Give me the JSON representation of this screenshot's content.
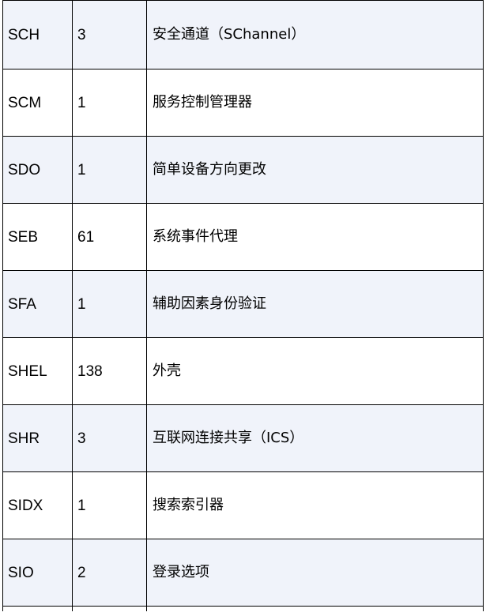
{
  "table": {
    "rows": [
      {
        "code": "SCH",
        "count": "3",
        "desc": "安全通道（SChannel）"
      },
      {
        "code": "SCM",
        "count": "1",
        "desc": "服务控制管理器"
      },
      {
        "code": "SDO",
        "count": "1",
        "desc": "简单设备方向更改"
      },
      {
        "code": "SEB",
        "count": "61",
        "desc": "系统事件代理"
      },
      {
        "code": "SFA",
        "count": "1",
        "desc": "辅助因素身份验证"
      },
      {
        "code": "SHEL",
        "count": "138",
        "desc": "外壳"
      },
      {
        "code": "SHR",
        "count": "3",
        "desc": "互联网连接共享（ICS）"
      },
      {
        "code": "SIDX",
        "count": "1",
        "desc": "搜索索引器"
      },
      {
        "code": "SIO",
        "count": "2",
        "desc": "登录选项"
      }
    ]
  },
  "colors": {
    "shaded_row": "#f0f3fa",
    "plain_row": "#ffffff",
    "border": "#000000"
  }
}
